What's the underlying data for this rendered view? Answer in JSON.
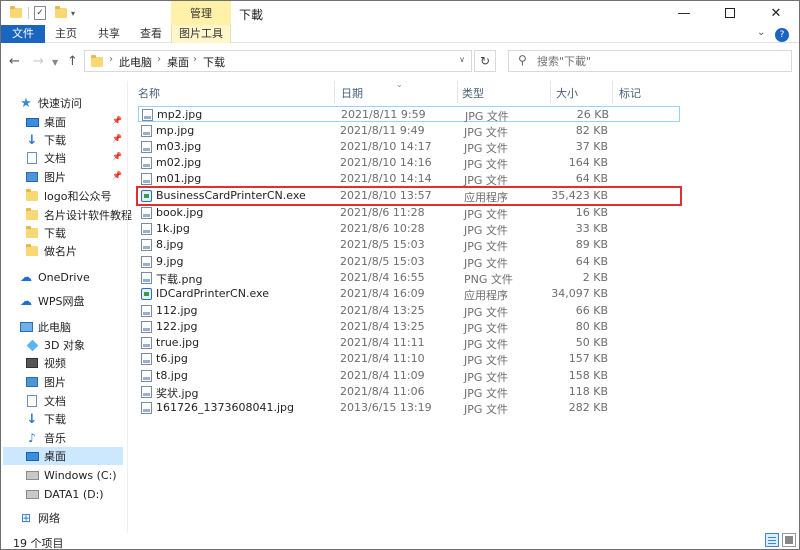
{
  "window": {
    "title": "下載",
    "context_tab_group": "管理"
  },
  "ribbon": {
    "tabs": [
      "文件",
      "主页",
      "共享",
      "查看",
      "图片工具"
    ]
  },
  "address": {
    "crumbs": [
      "此电脑",
      "桌面",
      "下载"
    ]
  },
  "search": {
    "placeholder": "搜索\"下載\""
  },
  "nav": {
    "quick_access": "快速访问",
    "quick_items": [
      "桌面",
      "下载",
      "文档",
      "图片",
      "logo和公众号",
      "名片设计软件教程",
      "下载",
      "做名片"
    ],
    "onedrive": "OneDrive",
    "wps": "WPS网盘",
    "this_pc": "此电脑",
    "pc_items": [
      "3D 对象",
      "视频",
      "图片",
      "文档",
      "下载",
      "音乐",
      "桌面",
      "Windows (C:)",
      "DATA1 (D:)"
    ],
    "network": "网络"
  },
  "columns": {
    "name": "名称",
    "date": "日期",
    "type": "类型",
    "size": "大小",
    "tags": "标记"
  },
  "files": [
    {
      "name": "mp2.jpg",
      "date": "2021/8/11 9:59",
      "type": "JPG 文件",
      "size": "26 KB"
    },
    {
      "name": "mp.jpg",
      "date": "2021/8/11 9:49",
      "type": "JPG 文件",
      "size": "82 KB"
    },
    {
      "name": "m03.jpg",
      "date": "2021/8/10 14:17",
      "type": "JPG 文件",
      "size": "37 KB"
    },
    {
      "name": "m02.jpg",
      "date": "2021/8/10 14:16",
      "type": "JPG 文件",
      "size": "164 KB"
    },
    {
      "name": "m01.jpg",
      "date": "2021/8/10 14:14",
      "type": "JPG 文件",
      "size": "64 KB"
    },
    {
      "name": "BusinessCardPrinterCN.exe",
      "date": "2021/8/10 13:57",
      "type": "应用程序",
      "size": "35,423 KB"
    },
    {
      "name": "book.jpg",
      "date": "2021/8/6 11:28",
      "type": "JPG 文件",
      "size": "16 KB"
    },
    {
      "name": "1k.jpg",
      "date": "2021/8/6 10:28",
      "type": "JPG 文件",
      "size": "33 KB"
    },
    {
      "name": "8.jpg",
      "date": "2021/8/5 15:03",
      "type": "JPG 文件",
      "size": "89 KB"
    },
    {
      "name": "9.jpg",
      "date": "2021/8/5 15:03",
      "type": "JPG 文件",
      "size": "64 KB"
    },
    {
      "name": "下载.png",
      "date": "2021/8/4 16:55",
      "type": "PNG 文件",
      "size": "2 KB"
    },
    {
      "name": "IDCardPrinterCN.exe",
      "date": "2021/8/4 16:09",
      "type": "应用程序",
      "size": "34,097 KB"
    },
    {
      "name": "112.jpg",
      "date": "2021/8/4 13:25",
      "type": "JPG 文件",
      "size": "66 KB"
    },
    {
      "name": "122.jpg",
      "date": "2021/8/4 13:25",
      "type": "JPG 文件",
      "size": "80 KB"
    },
    {
      "name": "true.jpg",
      "date": "2021/8/4 11:11",
      "type": "JPG 文件",
      "size": "50 KB"
    },
    {
      "name": "t6.jpg",
      "date": "2021/8/4 11:10",
      "type": "JPG 文件",
      "size": "157 KB"
    },
    {
      "name": "t8.jpg",
      "date": "2021/8/4 11:09",
      "type": "JPG 文件",
      "size": "158 KB"
    },
    {
      "name": "奖状.jpg",
      "date": "2021/8/4 11:06",
      "type": "JPG 文件",
      "size": "118 KB"
    },
    {
      "name": "161726_1373608041.jpg",
      "date": "2013/6/15 13:19",
      "type": "JPG 文件",
      "size": "282 KB"
    }
  ],
  "status": {
    "count_text": "19 个项目"
  }
}
